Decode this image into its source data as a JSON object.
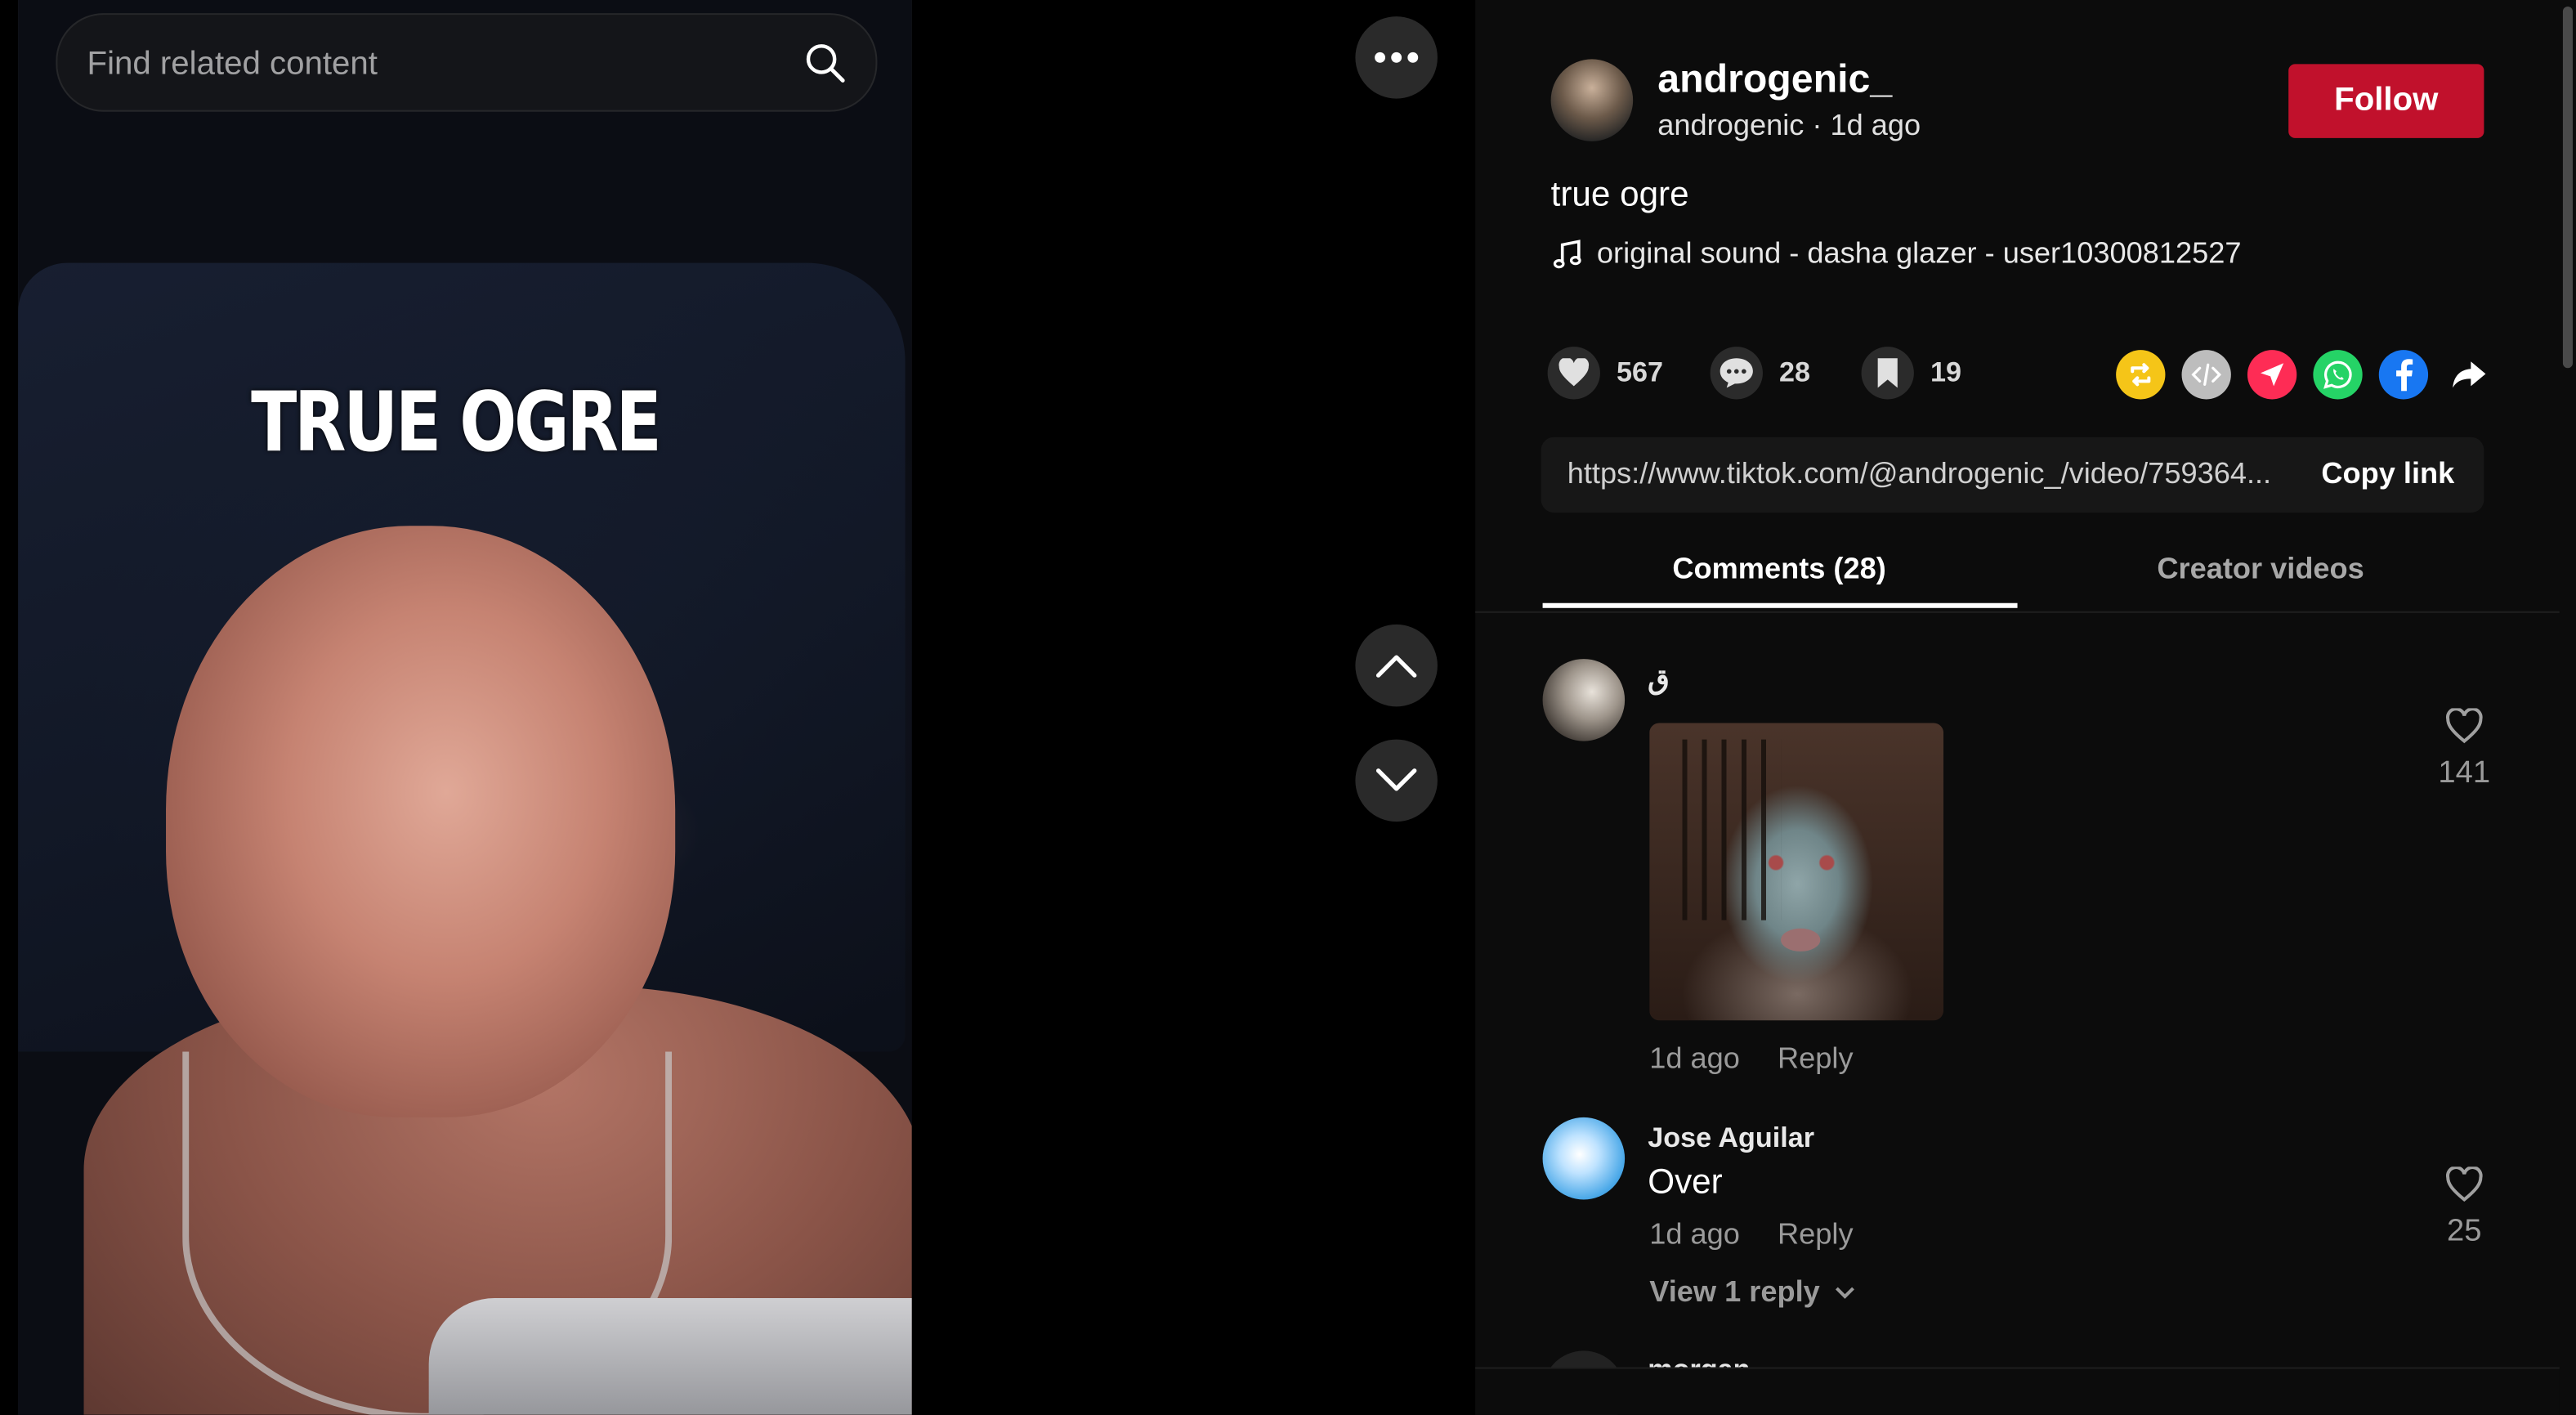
{
  "search": {
    "placeholder": "Find related content"
  },
  "video": {
    "caption_overlay": "TRUE OGRE"
  },
  "author": {
    "username": "androgenic_",
    "display_line": "androgenic · 1d ago",
    "follow_label": "Follow"
  },
  "post": {
    "caption": "true ogre",
    "sound": "original sound - dasha glazer - user10300812527"
  },
  "stats": {
    "likes": "567",
    "comments": "28",
    "saves": "19"
  },
  "share_icons": [
    {
      "name": "repost-icon",
      "color": "#f5c518"
    },
    {
      "name": "embed-icon",
      "color": "#bdbdbd"
    },
    {
      "name": "send-to-friends-icon",
      "color": "#fe2c55"
    },
    {
      "name": "whatsapp-icon",
      "color": "#25d366"
    },
    {
      "name": "facebook-icon",
      "color": "#1877f2"
    },
    {
      "name": "share-arrow-icon",
      "color": "#ffffff"
    }
  ],
  "link": {
    "url": "https://www.tiktok.com/@androgenic_/video/759364...",
    "copy_label": "Copy link"
  },
  "tabs": [
    {
      "label": "Comments (28)",
      "active": true
    },
    {
      "label": "Creator videos",
      "active": false
    }
  ],
  "comments": [
    {
      "username": "ق",
      "has_sticker": true,
      "time": "1d ago",
      "reply_label": "Reply",
      "likes": "141"
    },
    {
      "username": "Jose Aguilar",
      "text": "Over",
      "time": "1d ago",
      "reply_label": "Reply",
      "likes": "25",
      "view_replies": "View 1 reply"
    },
    {
      "username": "morgan"
    }
  ]
}
